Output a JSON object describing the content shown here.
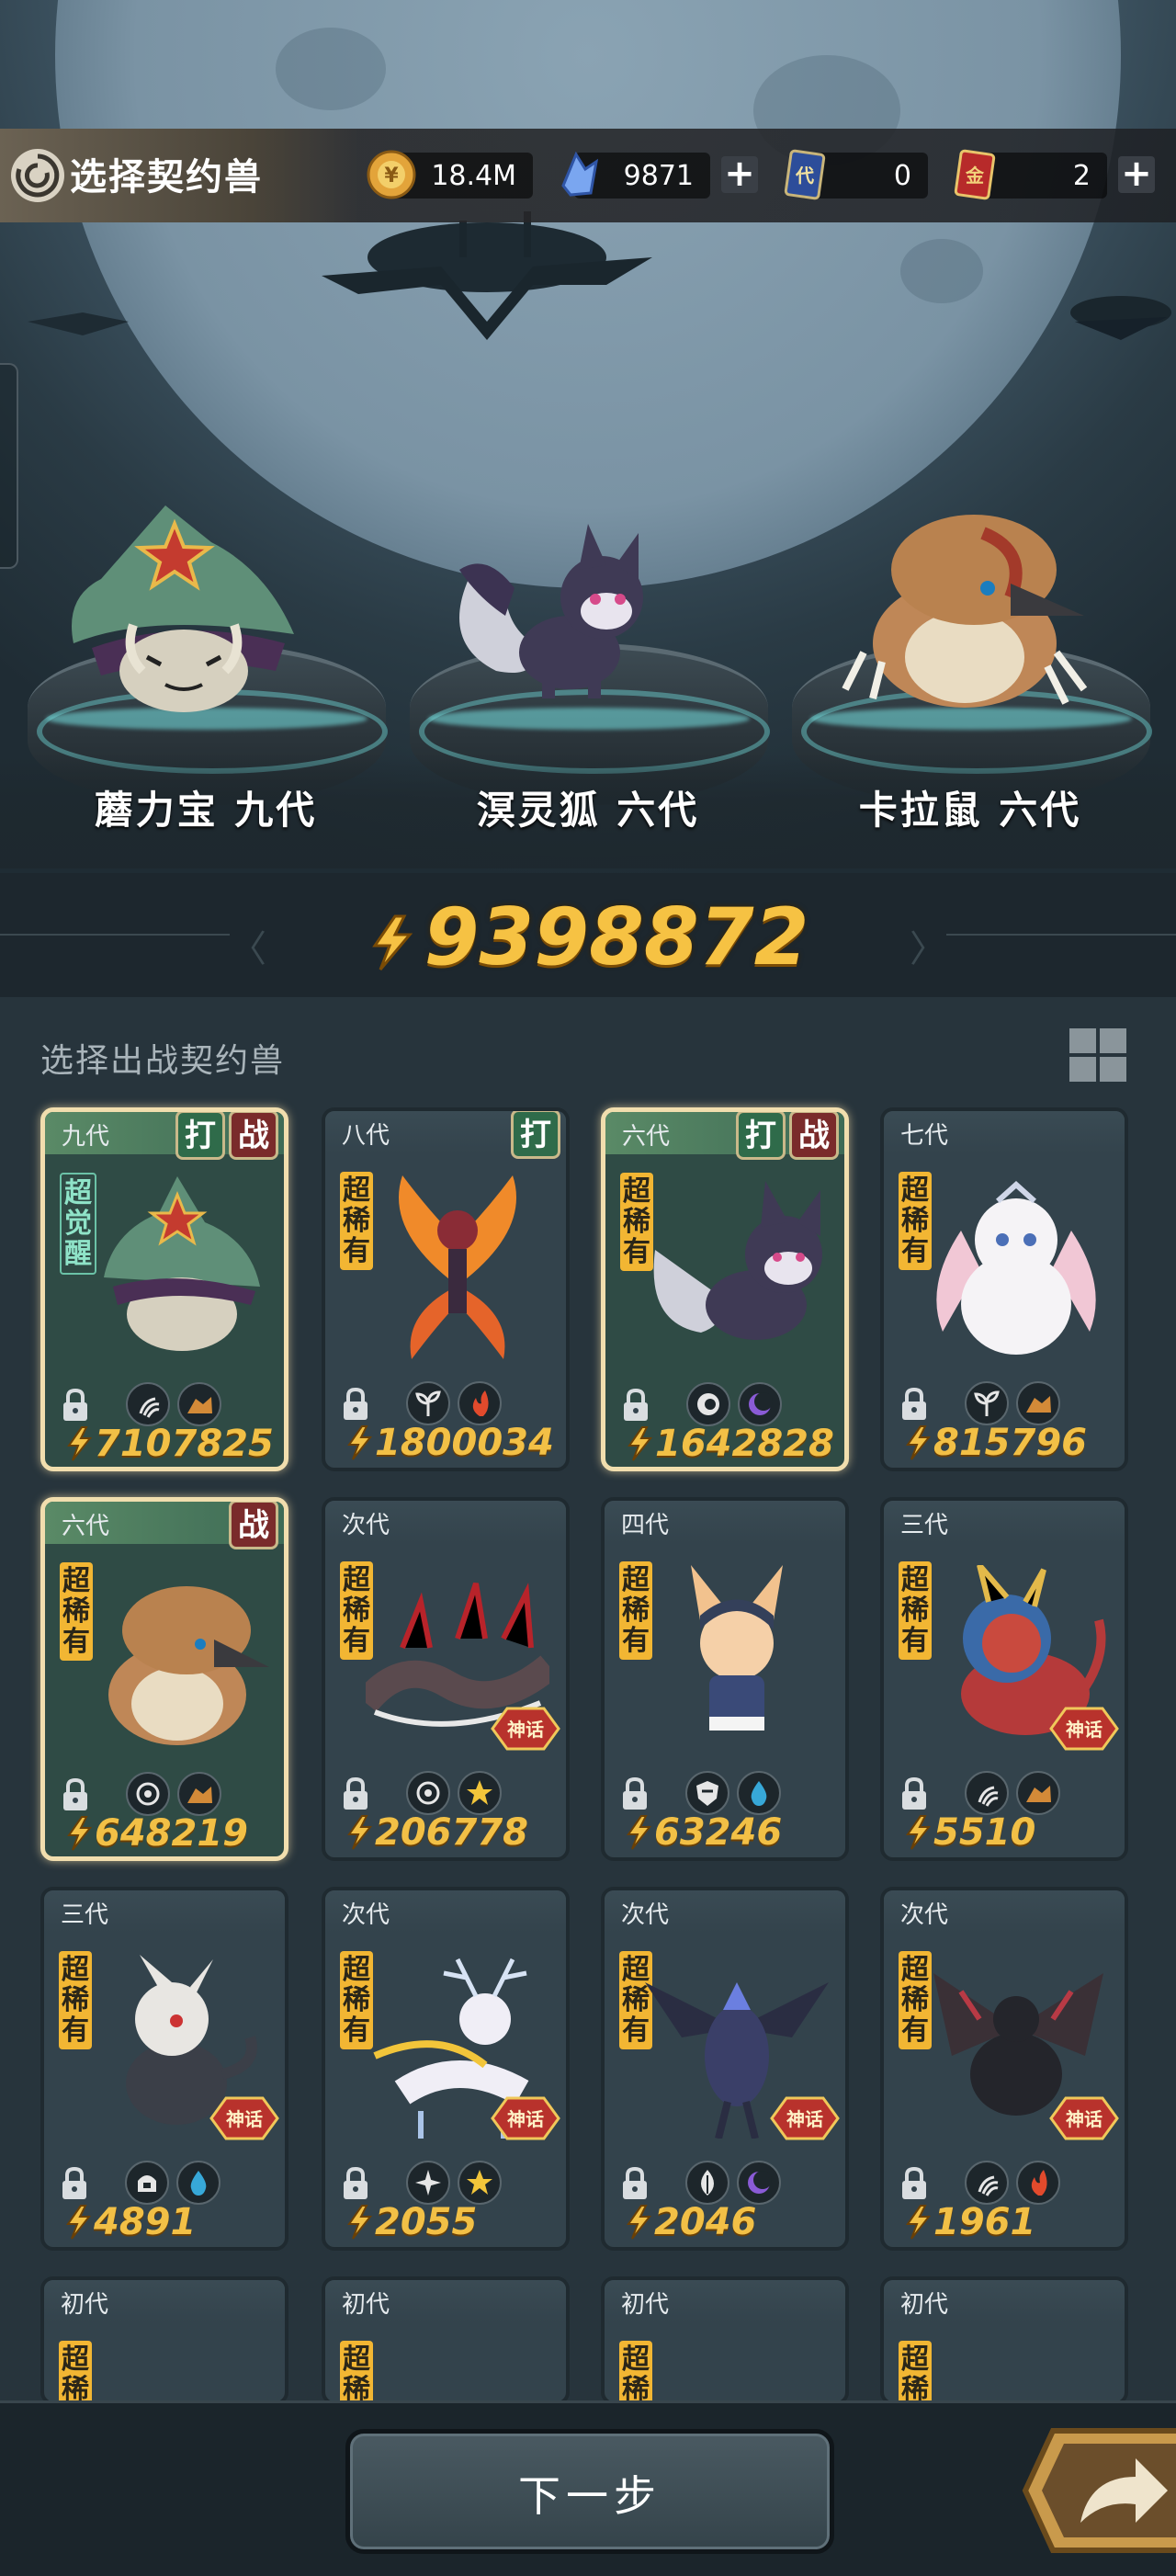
{
  "header": {
    "title": "选择契约兽",
    "resources": [
      {
        "name": "gold",
        "icon": "gold-coin-icon",
        "value": "18.4M",
        "has_plus": false
      },
      {
        "name": "crystal",
        "icon": "blue-crystal-icon",
        "value": "9871",
        "has_plus": true
      },
      {
        "name": "dai-card",
        "icon": "dai-card-icon",
        "card_char": "代",
        "value": "0",
        "has_plus": false
      },
      {
        "name": "gold-card",
        "icon": "gold-card-icon",
        "card_char": "金",
        "value": "2",
        "has_plus": true
      }
    ]
  },
  "team": [
    {
      "name": "蘑力宝 九代"
    },
    {
      "name": "溟灵狐 六代"
    },
    {
      "name": "卡拉鼠 六代"
    }
  ],
  "total_power": "9398872",
  "list": {
    "title": "选择出战契约兽",
    "cards": [
      {
        "gen": "九代",
        "rarity": "超觉醒",
        "awakened": true,
        "tags": [
          "打",
          "战"
        ],
        "power": "7107825",
        "selected": true,
        "elements": [
          "claw-icon",
          "rock-icon"
        ],
        "creature": "mushroom"
      },
      {
        "gen": "八代",
        "rarity": "超稀有",
        "tags": [
          "打"
        ],
        "power": "1800034",
        "selected": false,
        "elements": [
          "sprout-icon",
          "fire-icon"
        ],
        "creature": "fire-fairy"
      },
      {
        "gen": "六代",
        "rarity": "超稀有",
        "tags": [
          "打",
          "战"
        ],
        "power": "1642828",
        "selected": true,
        "elements": [
          "eye-icon",
          "moon-icon"
        ],
        "creature": "fox"
      },
      {
        "gen": "七代",
        "rarity": "超稀有",
        "tags": [],
        "power": "815796",
        "selected": false,
        "elements": [
          "sprout-icon",
          "rock-icon"
        ],
        "creature": "white-bunny"
      },
      {
        "gen": "六代",
        "rarity": "超稀有",
        "tags": [
          "战"
        ],
        "power": "648219",
        "selected": true,
        "elements": [
          "target-icon",
          "rock-icon"
        ],
        "creature": "mole"
      },
      {
        "gen": "次代",
        "rarity": "超稀有",
        "god": "神话",
        "tags": [],
        "power": "206778",
        "selected": false,
        "elements": [
          "target-icon",
          "star-icon"
        ],
        "creature": "dragon-serpent"
      },
      {
        "gen": "四代",
        "rarity": "超稀有",
        "tags": [],
        "power": "63246",
        "selected": false,
        "elements": [
          "shield-icon",
          "water-icon"
        ],
        "creature": "fox-girl"
      },
      {
        "gen": "三代",
        "rarity": "超稀有",
        "god": "神话",
        "tags": [],
        "power": "5510",
        "selected": false,
        "elements": [
          "claw-icon",
          "rock-icon"
        ],
        "creature": "red-lion"
      },
      {
        "gen": "三代",
        "rarity": "超稀有",
        "god": "神话",
        "tags": [],
        "power": "4891",
        "selected": false,
        "elements": [
          "helm-icon",
          "water-icon"
        ],
        "creature": "white-dragon"
      },
      {
        "gen": "次代",
        "rarity": "超稀有",
        "god": "神话",
        "tags": [],
        "power": "2055",
        "selected": false,
        "elements": [
          "compass-icon",
          "star-icon"
        ],
        "creature": "deer"
      },
      {
        "gen": "次代",
        "rarity": "超稀有",
        "god": "神话",
        "tags": [],
        "power": "2046",
        "selected": false,
        "elements": [
          "leaf-icon",
          "moon-icon"
        ],
        "creature": "dark-bird"
      },
      {
        "gen": "次代",
        "rarity": "超稀有",
        "god": "神话",
        "tags": [],
        "power": "1961",
        "selected": false,
        "elements": [
          "claw-icon",
          "fire-icon"
        ],
        "creature": "black-dragon"
      },
      {
        "gen": "初代",
        "rarity": "超稀有",
        "tags": [],
        "power": "",
        "selected": false,
        "elements": [],
        "creature": "partial"
      },
      {
        "gen": "初代",
        "rarity": "超稀有",
        "tags": [],
        "power": "",
        "selected": false,
        "elements": [],
        "creature": "partial"
      },
      {
        "gen": "初代",
        "rarity": "超稀有",
        "tags": [],
        "power": "",
        "selected": false,
        "elements": [],
        "creature": "partial"
      },
      {
        "gen": "初代",
        "rarity": "超稀有",
        "tags": [],
        "power": "",
        "selected": false,
        "elements": [],
        "creature": "partial"
      }
    ]
  },
  "bottom": {
    "next_label": "下一步",
    "share_icon": "share-arrow-icon"
  },
  "colors": {
    "power_gold": "#f6c243",
    "selected_border": "#f1deae",
    "rare_badge": "#f2b633",
    "tag_hit": "#2f6b4a",
    "tag_fight": "#7a2b2b"
  }
}
